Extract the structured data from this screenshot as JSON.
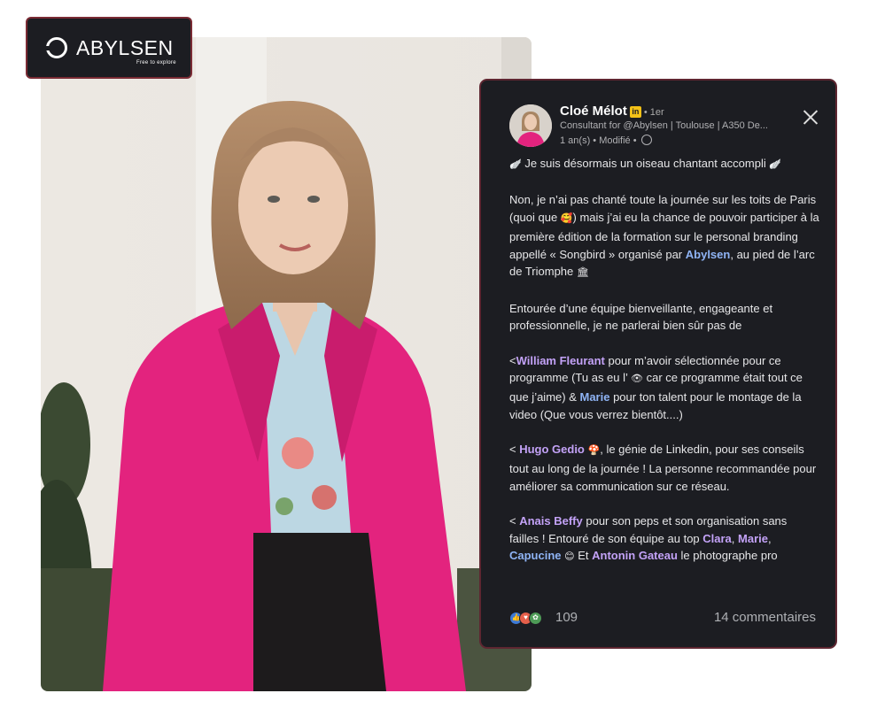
{
  "brand": {
    "name": "ABYLSEN",
    "tagline": "Free to explore"
  },
  "post": {
    "author": {
      "name": "Cloé Mélot",
      "badge": "in",
      "degree": "• 1er",
      "headline": "Consultant for @Abylsen | Toulouse | A350 De...",
      "meta": "1 an(s) • Modifié •"
    },
    "close_label": "×",
    "paragraphs": {
      "p1": {
        "emoji_a": "🪽",
        "text": "Je suis désormais un oiseau chantant accompli",
        "emoji_b": "🪽"
      },
      "p2": {
        "t1": "Non, je n’ai pas chanté toute la journée sur les toits de Paris (quoi que ",
        "emoji": "🥰",
        "t2": ") mais j’ai eu la chance de pouvoir participer à la première édition de la formation sur le personal branding appellé « Songbird » organisé par ",
        "mention": "Abylsen",
        "t3": ", au pied de l’arc de Triomphe ",
        "emoji2": "🏛"
      },
      "p3": {
        "text": "Entourée d’une équipe bienveillante, engageante et professionnelle, je ne parlerai bien sûr pas de"
      },
      "p4": {
        "t1": "<",
        "mention1": "William Fleurant",
        "t2": " pour m’avoir sélectionnée pour ce programme (Tu as eu l’ ",
        "emoji": "👁",
        "t3": " car ce programme était tout ce que j’aime) & ",
        "mention2": "Marie",
        "t4": " pour ton talent pour le montage de la video (Que vous verrez bientôt....)"
      },
      "p5": {
        "t1": "< ",
        "mention": "Hugo Gedio",
        "emoji": "🍄",
        "t2": ", le génie de Linkedin, pour ses conseils tout au long de la journée ! La personne recommandée pour améliorer sa communication sur ce réseau."
      },
      "p6": {
        "t1": "< ",
        "mention1": "Anais Beffy",
        "t2": " pour son peps et son organisation sans failles ! Entouré de son équipe au top ",
        "mention2": "Clara",
        "sep1": ", ",
        "mention3": "Marie",
        "sep2": ", ",
        "mention4": "Capucine",
        "emoji": "😊",
        "t3": " Et ",
        "mention5": "Antonin Gateau",
        "t4": " le photographe pro"
      }
    },
    "reactions": {
      "icons": [
        "like-icon",
        "love-icon",
        "support-icon"
      ],
      "count": "109"
    },
    "comments": "14 commentaires"
  },
  "colors": {
    "card_bg": "#1c1d22",
    "card_border": "#5e2631",
    "mention_blue": "#8fb4f5",
    "mention_purple": "#c3a2f7",
    "blazer_pink": "#e3237e"
  }
}
